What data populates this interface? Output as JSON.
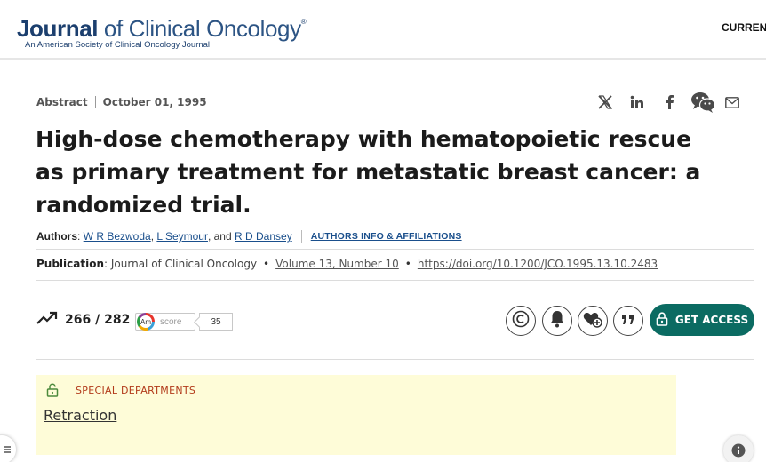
{
  "header": {
    "logo_bold": "Journal",
    "logo_rest": " of Clinical Oncology",
    "logo_mark": "®",
    "logo_sub": "An American Society of Clinical Oncology Journal",
    "nav_current": "CURRENT"
  },
  "article": {
    "type": "Abstract",
    "date": "October 01, 1995",
    "title": "High-dose chemotherapy with hematopoietic rescue as primary treatment for metastatic breast cancer: a randomized trial.",
    "authors_label": "Authors",
    "authors": [
      "W R Bezwoda",
      "L Seymour",
      "R D Dansey"
    ],
    "authors_and": ", and",
    "authors_info_link": "AUTHORS INFO & AFFILIATIONS",
    "publication_label": "Publication",
    "journal": "Journal of Clinical Oncology",
    "volume": "Volume 13, Number 10",
    "doi": "https://doi.org/10.1200/JCO.1995.13.10.2483"
  },
  "share_icons": [
    "x-icon",
    "linkedin-icon",
    "facebook-icon",
    "wechat-icon",
    "email-icon"
  ],
  "metrics": {
    "views": "266 / 282",
    "altmetric_label": "Am",
    "altmetric_score_label": "score",
    "altmetric_score": "35"
  },
  "actions": {
    "get_access_label": "GET ACCESS",
    "icons": [
      "copyright-icon",
      "bell-icon",
      "favorite-add-icon",
      "cite-icon"
    ],
    "accent_color": "#0b6b62"
  },
  "special": {
    "section_label": "SPECIAL DEPARTMENTS",
    "link_text": "Retraction",
    "background_color": "#fefcd8"
  }
}
